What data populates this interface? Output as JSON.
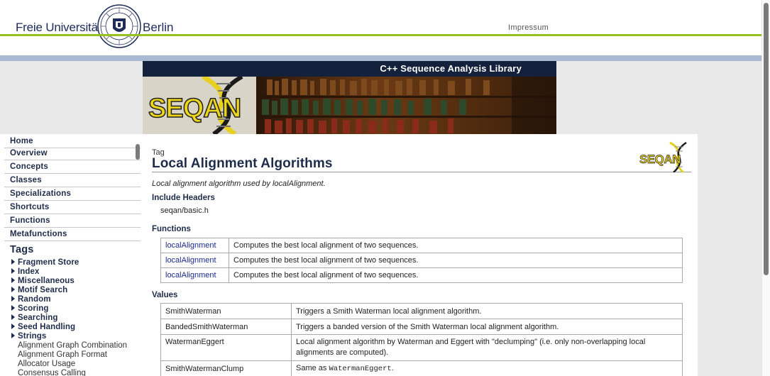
{
  "header": {
    "uni_left": "Freie Universität",
    "uni_right": "Berlin",
    "impressum": "Impressum"
  },
  "banner": {
    "title": "C++ Sequence Analysis Library",
    "logo_text": "SEQAN"
  },
  "sidebar": {
    "nav": [
      {
        "label": "Home"
      },
      {
        "label": "Overview"
      },
      {
        "label": "Concepts"
      },
      {
        "label": "Classes"
      },
      {
        "label": "Specializations"
      },
      {
        "label": "Shortcuts"
      },
      {
        "label": "Functions"
      },
      {
        "label": "Metafunctions"
      }
    ],
    "tags_title": "Tags",
    "tags": [
      {
        "label": "Fragment Store"
      },
      {
        "label": "Index"
      },
      {
        "label": "Miscellaneous"
      },
      {
        "label": "Motif Search"
      },
      {
        "label": "Random"
      },
      {
        "label": "Scoring"
      },
      {
        "label": "Searching"
      },
      {
        "label": "Seed Handling"
      },
      {
        "label": "Strings"
      }
    ],
    "sub_items": [
      {
        "label": "Alignment Graph Combination"
      },
      {
        "label": "Alignment Graph Format"
      },
      {
        "label": "Allocator Usage"
      },
      {
        "label": "Consensus Calling"
      }
    ]
  },
  "main": {
    "kind": "Tag",
    "title": "Local Alignment Algorithms",
    "mini_logo_text": "SEQAN",
    "description": "Local alignment algorithm used by localAlignment.",
    "include_heading": "Include Headers",
    "include_file": "seqan/basic.h",
    "functions_heading": "Functions",
    "functions": [
      {
        "name": "localAlignment",
        "desc": "Computes the best local alignment of two sequences."
      },
      {
        "name": "localAlignment",
        "desc": "Computes the best local alignment of two sequences."
      },
      {
        "name": "localAlignment",
        "desc": "Computes the best local alignment of two sequences."
      }
    ],
    "values_heading": "Values",
    "values": [
      {
        "name": "SmithWaterman",
        "desc": "Triggers a Smith Waterman local alignment algorithm."
      },
      {
        "name": "BandedSmithWaterman",
        "desc": "Triggers a banded version of the Smith Waterman local alignment algorithm."
      },
      {
        "name": "WatermanEggert",
        "desc": "Local alignment algorithm by Waterman and Eggert with \"declumping\" (i.e. only non-overlapping local alignments are computed)."
      },
      {
        "name": "SmithWatermanClump",
        "desc_prefix": "Same as ",
        "desc_code": "WatermanEggert",
        "desc_suffix": "."
      }
    ]
  }
}
